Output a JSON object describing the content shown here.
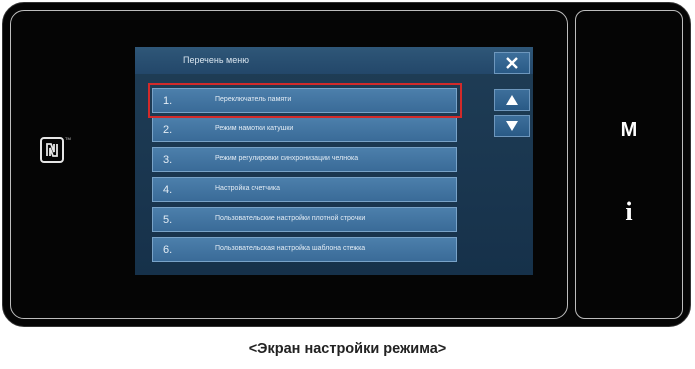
{
  "menu": {
    "title": "Перечень меню",
    "items": [
      {
        "number": "1.",
        "label": "Переключатель памяти"
      },
      {
        "number": "2.",
        "label": "Режим намотки катушки"
      },
      {
        "number": "3.",
        "label": "Режим регулировки синхронизации челнока"
      },
      {
        "number": "4.",
        "label": "Настройка счетчика"
      },
      {
        "number": "5.",
        "label": "Пользовательские настройки плотной строчки"
      },
      {
        "number": "6.",
        "label": "Пользовательская настройка шаблона стежка"
      }
    ],
    "selected_index": 0
  },
  "side_panel": {
    "m_key": "M",
    "info_key": "i"
  },
  "icons": {
    "nfc": "nfc-icon",
    "close": "close-icon",
    "up": "arrow-up-icon",
    "down": "arrow-down-icon"
  },
  "caption": "<Экран настройки режима>",
  "colors": {
    "selection": "#d22a2a",
    "item_bg": "#4c7fab",
    "window_bg": "#1f3d56"
  }
}
